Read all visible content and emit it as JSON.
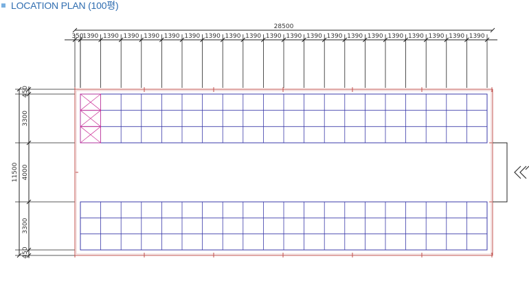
{
  "title": "LOCATION PLAN (100평)",
  "colors": {
    "title": "#2f6db0",
    "bullet": "#7ab0e0",
    "grid": "#3a3aa8",
    "outline": "#c0504d",
    "dim": "#222222",
    "cross": "#cc3399"
  },
  "dimensions": {
    "total_width": "28500",
    "edge_left": "350",
    "bay": "1390",
    "bay_count": 20,
    "total_height": "11500",
    "edge_margin": "450",
    "block_depth": "3300",
    "aisle": "4000"
  },
  "layout": {
    "rows_per_block": 3,
    "cols_per_block": 20,
    "crossed_cells_top_block": 3
  },
  "entrance_icon": "double-chevron-left-icon"
}
